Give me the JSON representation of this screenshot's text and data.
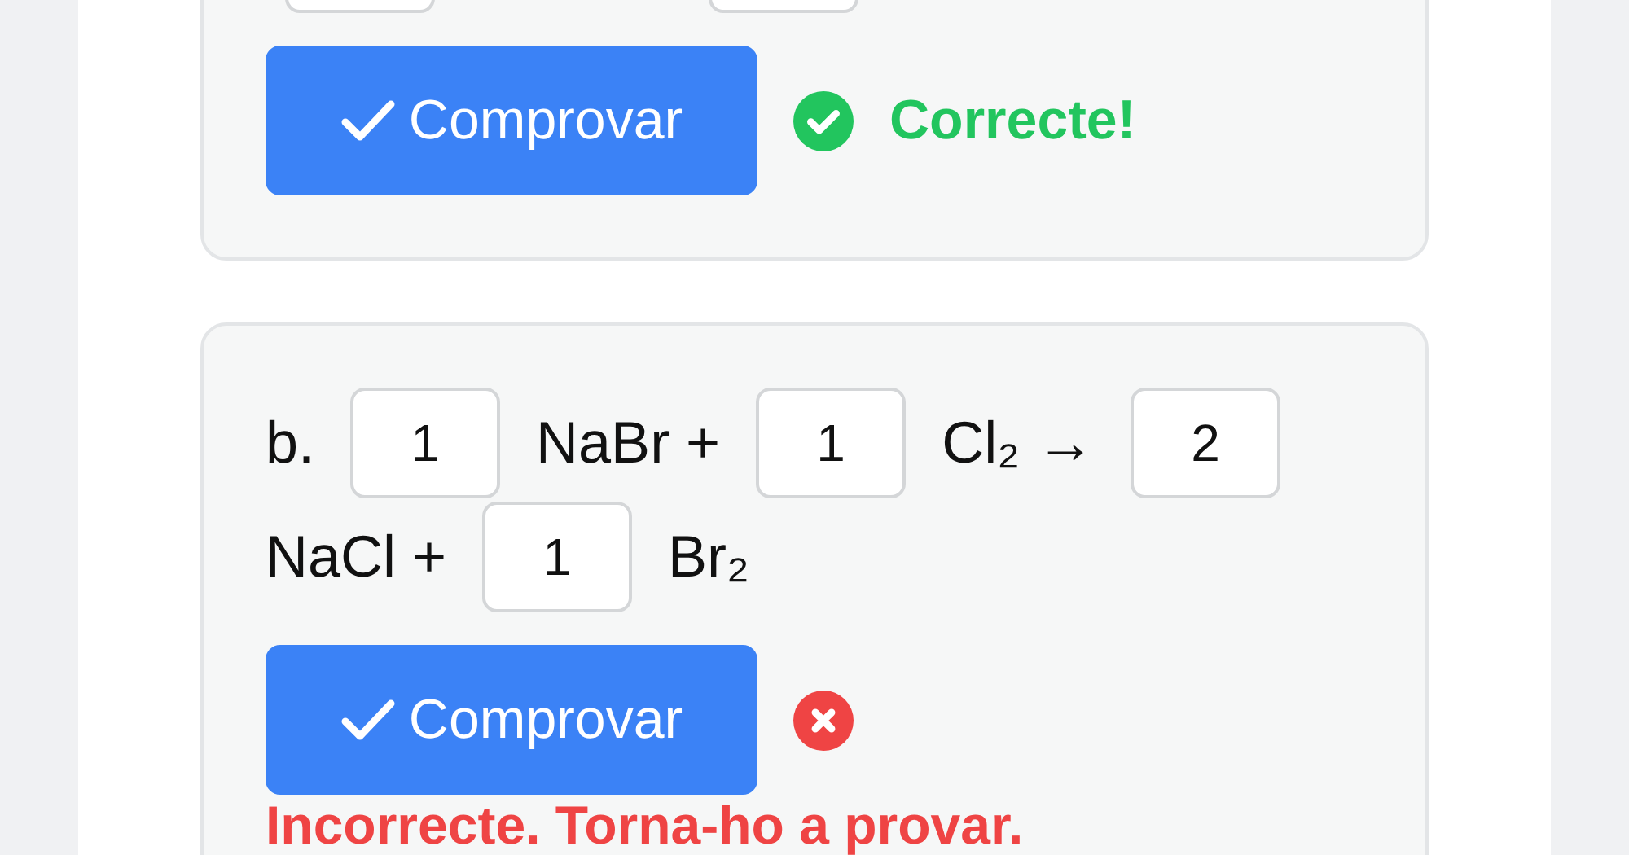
{
  "exercises": [
    {
      "cut_top": true,
      "terms": [
        {
          "kind": "input"
        },
        {
          "kind": "input"
        }
      ],
      "button": "Comprovar",
      "result": {
        "kind": "correct",
        "message": "Correcte!"
      }
    },
    {
      "cut_top": false,
      "terms": [
        {
          "kind": "text",
          "text": "b."
        },
        {
          "kind": "input",
          "value": "1"
        },
        {
          "kind": "text",
          "text": "NaBr +"
        },
        {
          "kind": "input",
          "value": "1"
        },
        {
          "kind": "text",
          "text": "Cl₂ →"
        },
        {
          "kind": "input",
          "value": "2"
        },
        {
          "kind": "text",
          "text": "NaCl +"
        },
        {
          "kind": "input",
          "value": "1"
        },
        {
          "kind": "text",
          "text": "Br₂"
        }
      ],
      "button": "Comprovar",
      "result": {
        "kind": "incorrect",
        "message": "Incorrecte. Torna-ho a provar."
      }
    }
  ]
}
